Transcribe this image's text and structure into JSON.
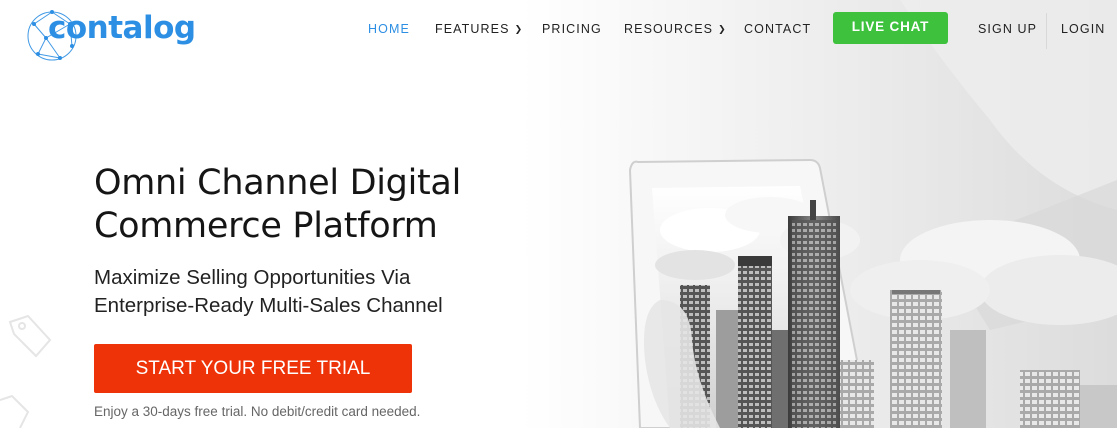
{
  "brand": {
    "name": "contalog",
    "color": "#2d8fe3"
  },
  "nav": {
    "home": "HOME",
    "features": "FEATURES",
    "pricing": "PRICING",
    "resources": "RESOURCES",
    "contact": "CONTACT",
    "live_chat": "LIVE CHAT",
    "sign_up": "SIGN UP",
    "login": "LOGIN",
    "chevron": "chevron-down-icon",
    "active_color": "#2d8fe3",
    "live_chat_color": "#3ec13c"
  },
  "hero": {
    "title_line1": "Omni Channel Digital",
    "title_line2": "Commerce Platform",
    "subtitle_line1": "Maximize Selling Opportunities Via",
    "subtitle_line2": "Enterprise-Ready Multi-Sales Channel",
    "cta_label": "START YOUR FREE TRIAL",
    "cta_color": "#ee3308",
    "note": "Enjoy a 30-days free trial. No debit/credit card needed."
  }
}
